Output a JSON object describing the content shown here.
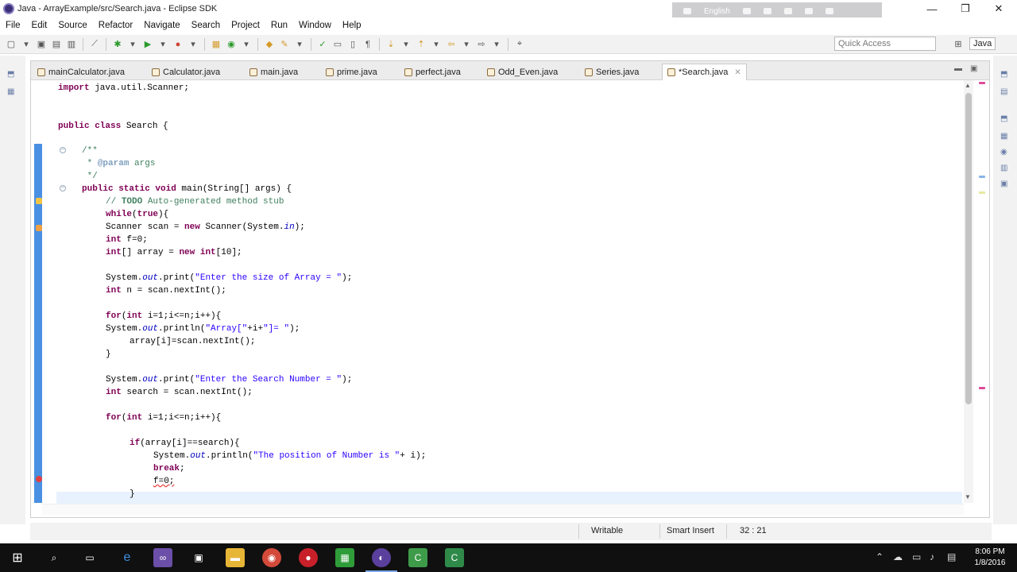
{
  "window": {
    "title": "Java - ArrayExample/src/Search.java - Eclipse SDK",
    "overlay_label": "English",
    "controls": [
      "—",
      "❐",
      "✕"
    ]
  },
  "menu": {
    "items": [
      "File",
      "Edit",
      "Source",
      "Refactor",
      "Navigate",
      "Search",
      "Project",
      "Run",
      "Window",
      "Help"
    ]
  },
  "toolbar": {
    "quick_access_placeholder": "Quick Access",
    "perspective": "Java"
  },
  "tabs": [
    {
      "label": "mainCalculator.java"
    },
    {
      "label": "Calculator.java"
    },
    {
      "label": "main.java"
    },
    {
      "label": "prime.java"
    },
    {
      "label": "perfect.java"
    },
    {
      "label": "Odd_Even.java"
    },
    {
      "label": "Series.java"
    },
    {
      "label": "*Search.java",
      "active": true
    }
  ],
  "code": {
    "lines": [
      "import java.util.Scanner;",
      "",
      "",
      "public class Search {",
      "",
      "",
      "    /**",
      "     * @param args",
      "     */",
      "    public static void main(String[] args) {",
      "        // TODO Auto-generated method stub",
      "        while(true){",
      "        Scanner scan = new Scanner(System.in);",
      "        int f=0;",
      "        int[] array = new int[10];",
      "",
      "        System.out.print(\"Enter the size of Array = \");",
      "        int n = scan.nextInt();",
      "",
      "        for(int i=1;i<=n;i++){",
      "        System.out.println(\"Array[\"+i+\"]= \");",
      "            array[i]=scan.nextInt();",
      "        }",
      "",
      "        System.out.print(\"Enter the Search Number = \");",
      "        int search = scan.nextInt();",
      "",
      "        for(int i=1;i<=n;i++){",
      "",
      "            if(array[i]==search){",
      "                System.out.println(\"The position of Number is \"+ i);",
      "                break;",
      "                f=0;",
      "            }"
    ]
  },
  "status": {
    "mode": "Writable",
    "insert": "Smart Insert",
    "position": "32 : 21"
  },
  "clock": {
    "time": "8:06 PM",
    "date": "1/8/2016"
  },
  "colors": {
    "keyword": "#7f0055",
    "string": "#2a00ff",
    "comment": "#3f7f5f",
    "field": "#0000c0",
    "ruler": "#4a90e2"
  }
}
